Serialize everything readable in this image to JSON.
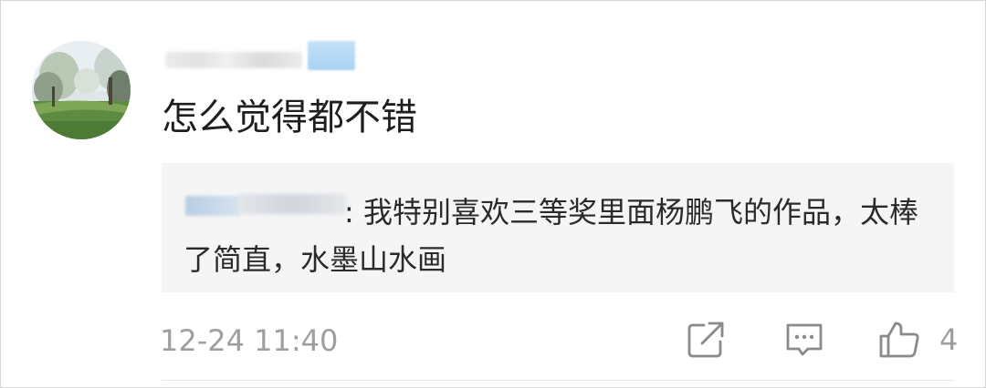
{
  "comment": {
    "username": "",
    "text": "怎么觉得都不错",
    "avatar_icon": "avatar-landscape-photo"
  },
  "reply": {
    "username": "",
    "prefix": ":",
    "text": "我特别喜欢三等奖里面杨鹏飞的作品，太棒了简直，水墨山水画"
  },
  "meta": {
    "timestamp": "12-24 11:40",
    "like_count": "4"
  },
  "icons": {
    "share": "share-icon",
    "comment": "comment-icon",
    "like": "thumbs-up-icon"
  },
  "colors": {
    "text_primary": "#1e1e1e",
    "text_secondary": "#9e9e9e",
    "reply_bg": "#f5f5f5",
    "username_highlight": "#a9d2f2"
  }
}
